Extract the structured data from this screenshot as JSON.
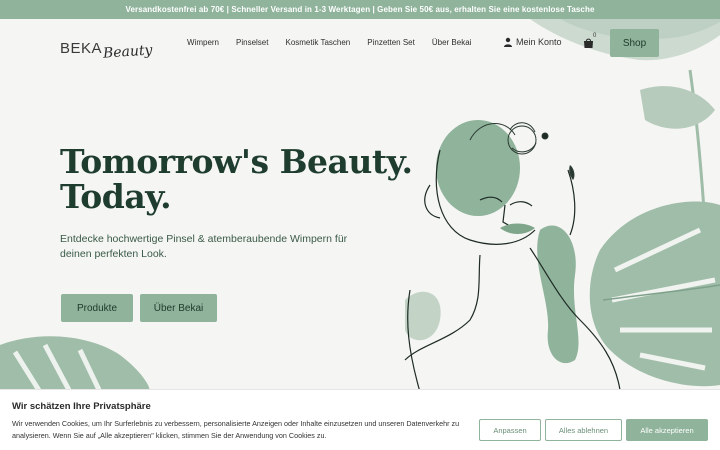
{
  "announcement": "Versandkostenfrei ab 70€ | Schneller Versand in 1-3 Werktagen | Geben Sie 50€ aus, erhalten Sie eine kostenlose Tasche",
  "logo": {
    "part1": "BEKA",
    "part2": "Beauty"
  },
  "nav": {
    "items": [
      "Wimpern",
      "Pinselset",
      "Kosmetik Taschen",
      "Pinzetten Set",
      "Über Bekai"
    ]
  },
  "account": {
    "label": "Mein Konto"
  },
  "cart": {
    "count": "0"
  },
  "shop_button": "Shop",
  "hero": {
    "title_line1": "Tomorrow's Beauty.",
    "title_line2": "Today.",
    "subtitle": "Entdecke hochwertige Pinsel & atemberaubende Wimpern für deinen perfekten Look.",
    "button_products": "Produkte",
    "button_about": "Über Bekai"
  },
  "cookie": {
    "title": "Wir schätzen Ihre Privatsphäre",
    "text": "Wir verwenden Cookies, um Ihr Surferlebnis zu verbessern, personalisierte Anzeigen oder Inhalte einzusetzen und unseren Datenverkehr zu analysieren. Wenn Sie auf „Alle akzeptieren\" klicken, stimmen Sie der Anwendung von Cookies zu.",
    "btn_customize": "Anpassen",
    "btn_reject": "Alles ablehnen",
    "btn_accept": "Alle akzeptieren"
  },
  "colors": {
    "accent": "#8fb39b",
    "heading": "#1e3d2f",
    "background": "#f5f5f3"
  }
}
